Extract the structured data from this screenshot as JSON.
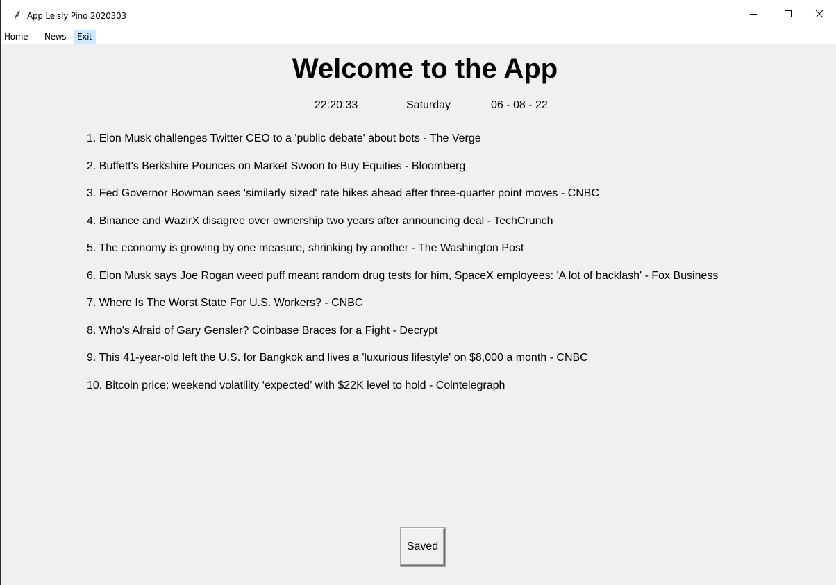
{
  "window": {
    "title": "App Leisly Pino 2020303",
    "app_icon": "feather-icon",
    "controls": {
      "minimize_icon": "minimize-icon",
      "maximize_icon": "maximize-icon",
      "close_icon": "close-icon"
    }
  },
  "menu": {
    "items": [
      {
        "label": "Home"
      },
      {
        "label": "News"
      },
      {
        "label": "Exit"
      }
    ],
    "highlight_color": "#cce8ff"
  },
  "main": {
    "title": "Welcome to the App",
    "clock": {
      "time": "22:20:33",
      "day": "Saturday",
      "date": "06 - 08 - 22"
    },
    "headlines": [
      "1. Elon Musk challenges Twitter CEO to a 'public debate' about bots - The Verge",
      "2. Buffett's Berkshire Pounces on Market Swoon to Buy Equities - Bloomberg",
      "3. Fed Governor Bowman sees 'similarly sized' rate hikes ahead after three-quarter point moves - CNBC",
      "4. Binance and WazirX disagree over ownership two years after announcing deal - TechCrunch",
      "5. The economy is growing by one measure, shrinking by another - The Washington Post",
      "6. Elon Musk says Joe Rogan weed puff meant random drug tests for him, SpaceX employees: 'A lot of backlash' - Fox Business",
      "7. Where Is The Worst State For U.S. Workers? - CNBC",
      "8. Who's Afraid of Gary Gensler? Coinbase Braces for a Fight - Decrypt",
      "9. This 41-year-old left the U.S. for Bangkok and lives a 'luxurious lifestyle' on $8,000 a month - CNBC",
      "10. Bitcoin price: weekend volatility ‘expected’ with $22K level to hold - Cointelegraph"
    ],
    "saved_button_label": "Saved"
  },
  "colors": {
    "background": "#f0f0f0",
    "titlebar": "#ffffff",
    "text": "#000000"
  }
}
